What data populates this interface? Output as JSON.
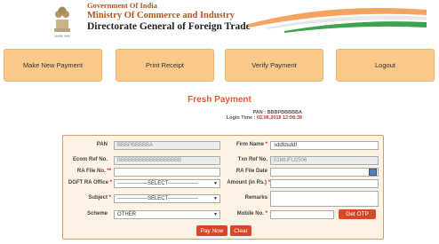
{
  "header": {
    "org_line1": "Government Of India",
    "org_line2": "Ministry Of Commerce and Industry",
    "org_line3": "Directorate General of Foreign Trade"
  },
  "nav": {
    "make_payment": "Make New Payment",
    "print_receipt": "Print Receipt",
    "verify_payment": "Verify Payment",
    "logout": "Logout"
  },
  "page_title": "Fresh Payment",
  "pan_label": "PAN : ",
  "pan_value": "BBBPBBBBBA",
  "login_label": "Login Time : ",
  "login_time": "02.08.2018 12:08:38",
  "form": {
    "pan_label": "PAN",
    "pan_value": "BBBPBBBBBA",
    "firm_name_label": "Firm Name",
    "firm_name_value": "sddfdsddf",
    "ecom_ref_label": "Ecom Ref No.",
    "ecom_ref_value": "BBBBBBBBBBBBBBBBBB",
    "txn_ref_label": "Txn Ref No.",
    "txn_ref_value": "01MUFU2506",
    "ra_file_label": "RA File No.",
    "ra_file_value": "",
    "ra_file_date_label": "RA File Date",
    "ra_file_date_value": "",
    "dgft_ra_office_label": "DGFT RA Office",
    "dgft_ra_office_value": "-----------------SELECT-----------------",
    "amount_label": "Amount (in Rs.)",
    "amount_value": "",
    "subject_label": "Subject",
    "subject_value": "-----------------SELECT-----------------",
    "remarks_label": "Remarks",
    "scheme_label": "Scheme",
    "scheme_value": "OTHER",
    "mobile_label": "Mobile No.",
    "mobile_value": "",
    "get_otp": "Get OTP",
    "pay_now": "Pay Now",
    "clear": "Clear",
    "req_mark": "*",
    "req_mark_double": "**"
  },
  "colors": {
    "nav_bg": "#f9c98a",
    "title": "#e06030",
    "button_red": "#d9472b",
    "form_bg": "#fdf2e4"
  }
}
